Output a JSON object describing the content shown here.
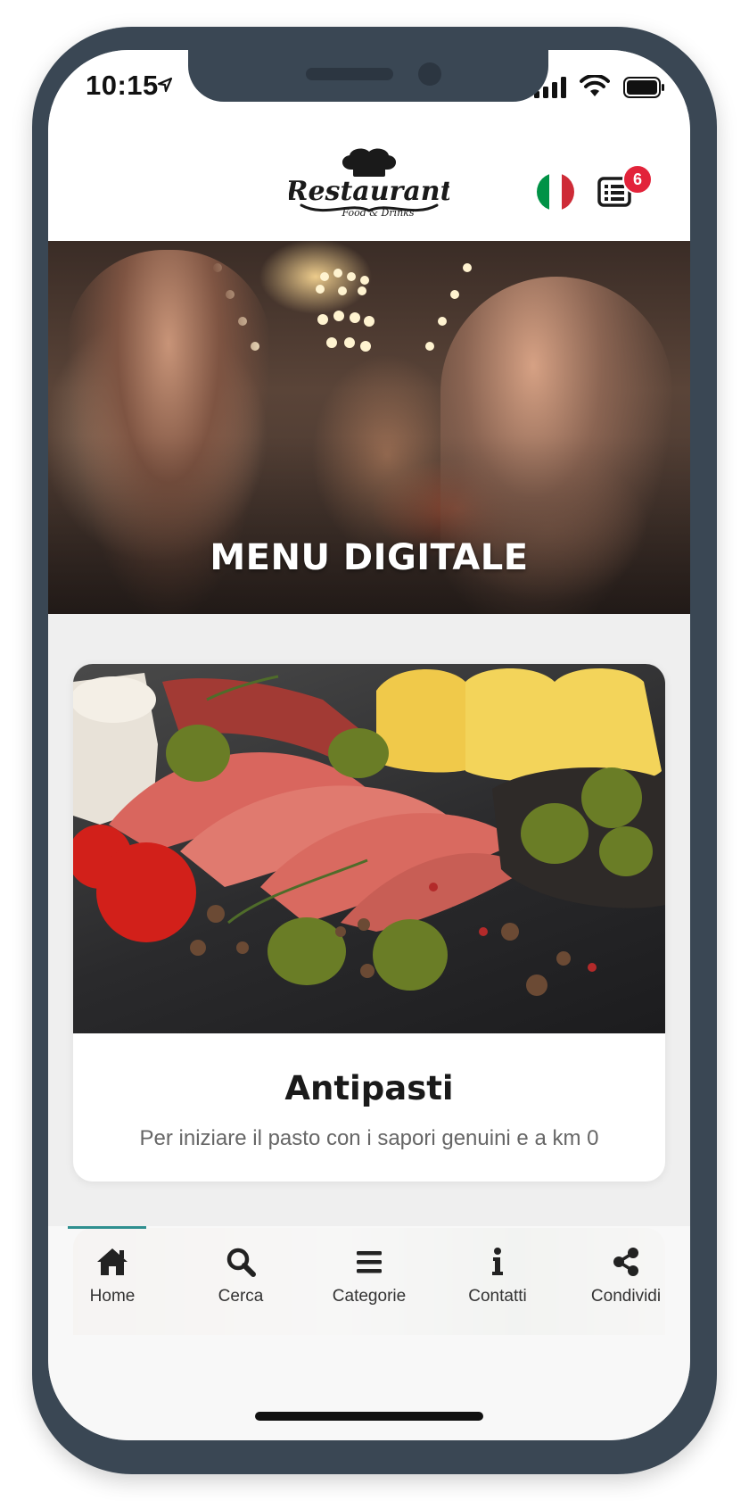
{
  "status_bar": {
    "time": "10:15",
    "icons": [
      "location-arrow-icon",
      "cellular-signal-icon",
      "wifi-icon",
      "battery-icon"
    ]
  },
  "header": {
    "logo_text": "Restaurant",
    "logo_tagline": "Food & Drinks",
    "language_flag": "italian-flag-icon",
    "cart_icon": "order-list-icon",
    "cart_badge": "6"
  },
  "hero": {
    "title": "MENU DIGITALE"
  },
  "categories": [
    {
      "title": "Antipasti",
      "description": "Per iniziare il pasto con i sapori genuini e a km 0"
    }
  ],
  "tabbar": {
    "items": [
      {
        "label": "Home",
        "icon": "home-icon"
      },
      {
        "label": "Cerca",
        "icon": "search-icon"
      },
      {
        "label": "Categorie",
        "icon": "menu-icon"
      },
      {
        "label": "Contatti",
        "icon": "info-icon"
      },
      {
        "label": "Condividi",
        "icon": "share-icon"
      }
    ]
  },
  "colors": {
    "frame": "#3a4754",
    "badge": "#e2233a",
    "tab_indicator": "#2f8f8f",
    "flag_green": "#009246",
    "flag_white": "#ffffff",
    "flag_red": "#ce2b37"
  }
}
